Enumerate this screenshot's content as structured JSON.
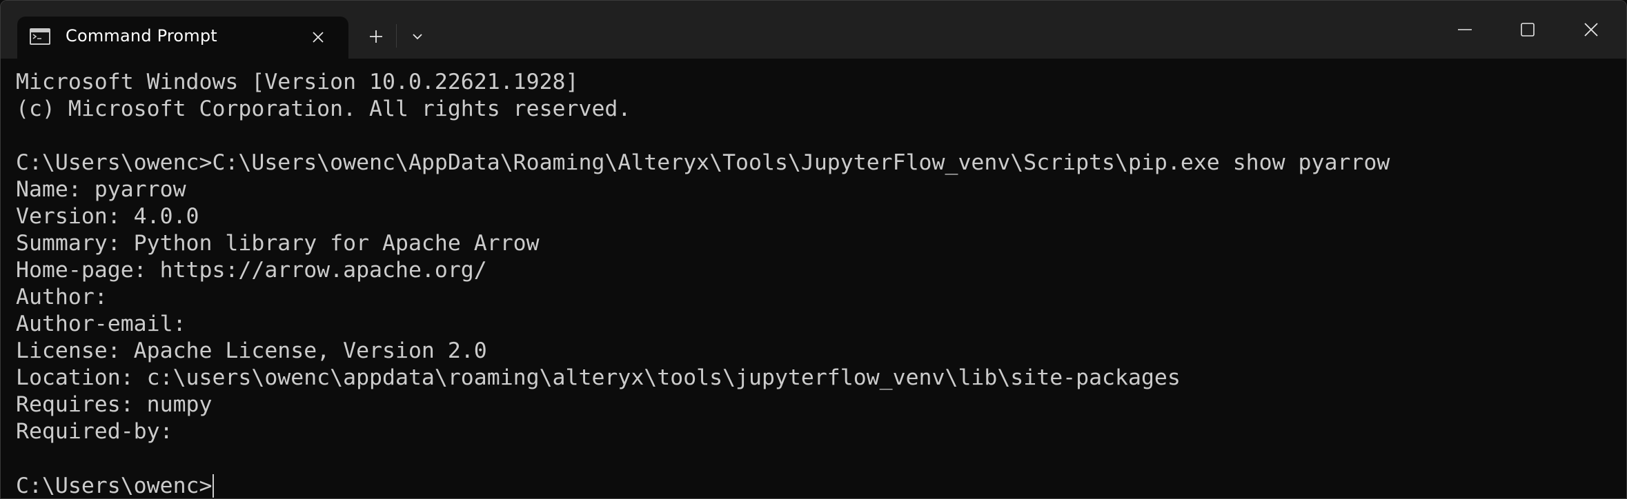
{
  "window": {
    "tab_title": "Command Prompt",
    "icons": {
      "tab_icon": "terminal-icon",
      "tab_close": "close-icon",
      "new_tab": "plus-icon",
      "dropdown": "chevron-down-icon",
      "minimize": "minimize-icon",
      "maximize": "maximize-icon",
      "close": "close-icon"
    }
  },
  "terminal": {
    "lines": [
      "Microsoft Windows [Version 10.0.22621.1928]",
      "(c) Microsoft Corporation. All rights reserved.",
      "",
      "C:\\Users\\owenc>C:\\Users\\owenc\\AppData\\Roaming\\Alteryx\\Tools\\JupyterFlow_venv\\Scripts\\pip.exe show pyarrow",
      "Name: pyarrow",
      "Version: 4.0.0",
      "Summary: Python library for Apache Arrow",
      "Home-page: https://arrow.apache.org/",
      "Author:",
      "Author-email:",
      "License: Apache License, Version 2.0",
      "Location: c:\\users\\owenc\\appdata\\roaming\\alteryx\\tools\\jupyterflow_venv\\lib\\site-packages",
      "Requires: numpy",
      "Required-by:",
      ""
    ],
    "prompt": "C:\\Users\\owenc>"
  },
  "colors": {
    "background": "#0c0c0c",
    "titlebar": "#202020",
    "text": "#cccccc"
  }
}
